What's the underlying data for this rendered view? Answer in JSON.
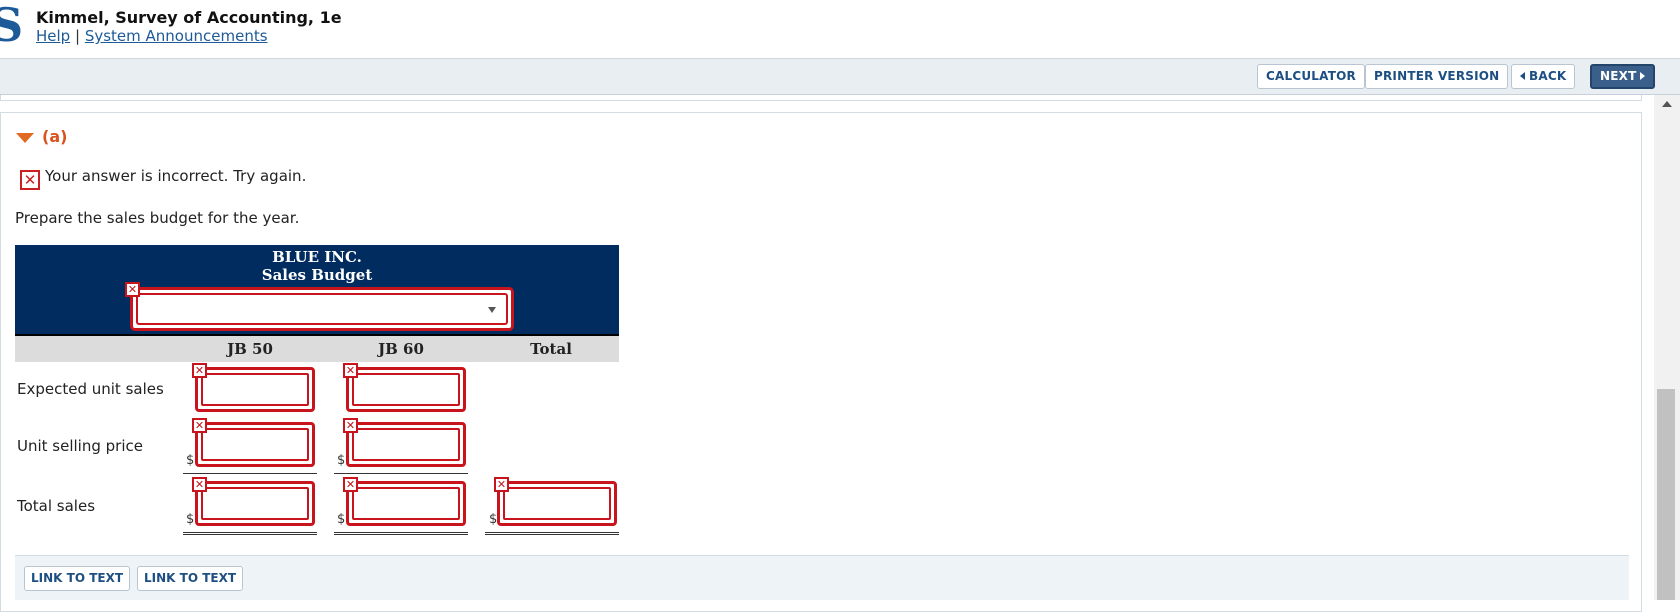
{
  "header": {
    "logo_letter": "S",
    "book_title": "Kimmel, Survey of Accounting, 1e",
    "help_link": "Help",
    "separator": "|",
    "announcements_link": "System Announcements"
  },
  "toolbar": {
    "calculator": "CALCULATOR",
    "printer_version": "PRINTER VERSION",
    "back": "BACK",
    "next": "NEXT"
  },
  "question": {
    "part_label": "(a)",
    "feedback": "Your answer is incorrect.  Try again.",
    "prompt": "Prepare the sales budget for the year."
  },
  "table": {
    "company": "BLUE INC.",
    "title": "Sales Budget",
    "period_select_value": "",
    "columns": [
      "JB 50",
      "JB 60",
      "Total"
    ],
    "rows": [
      {
        "label": "Expected unit sales",
        "jb50": "",
        "jb60": ""
      },
      {
        "label": "Unit selling price",
        "jb50": "",
        "jb60": ""
      },
      {
        "label": "Total sales",
        "jb50": "",
        "jb60": "",
        "total": ""
      }
    ],
    "currency_symbol": "$"
  },
  "footer": {
    "link1": "LINK TO TEXT",
    "link2": "LINK TO TEXT"
  },
  "colors": {
    "header_blue": "#002c5f",
    "error_red": "#c8141c",
    "accent_orange": "#d9531e"
  }
}
